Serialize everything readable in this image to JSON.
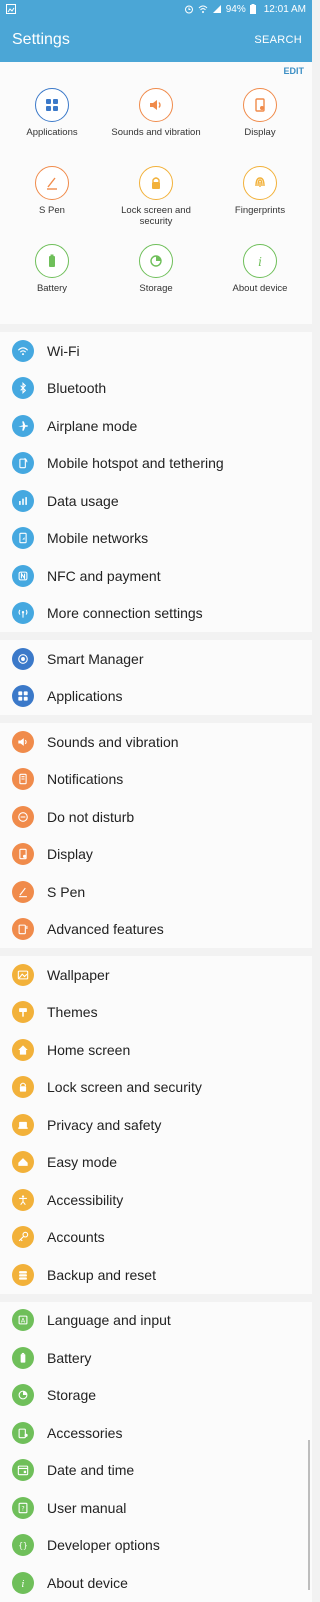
{
  "status": {
    "battery": "94%",
    "time": "12:01 AM"
  },
  "appbar": {
    "title": "Settings",
    "search": "SEARCH"
  },
  "quick": {
    "edit": "EDIT",
    "items": [
      {
        "label": "Applications",
        "icon": "apps-grid-icon",
        "color": "#3b79c9"
      },
      {
        "label": "Sounds and vibration",
        "icon": "speaker-icon",
        "color": "#f08b4b"
      },
      {
        "label": "Display",
        "icon": "display-icon",
        "color": "#f08b4b"
      },
      {
        "label": "S Pen",
        "icon": "pen-icon",
        "color": "#f08b4b"
      },
      {
        "label": "Lock screen and security",
        "icon": "lock-icon",
        "color": "#f2b13a"
      },
      {
        "label": "Fingerprints",
        "icon": "fingerprint-icon",
        "color": "#f2b13a"
      },
      {
        "label": "Battery",
        "icon": "battery-icon",
        "color": "#6fbf5a"
      },
      {
        "label": "Storage",
        "icon": "storage-icon",
        "color": "#6fbf5a"
      },
      {
        "label": "About device",
        "icon": "info-icon",
        "color": "#6fbf5a"
      }
    ]
  },
  "sections": [
    {
      "color": "#45a8e0",
      "items": [
        {
          "label": "Wi-Fi",
          "icon": "wifi-icon"
        },
        {
          "label": "Bluetooth",
          "icon": "bluetooth-icon"
        },
        {
          "label": "Airplane mode",
          "icon": "airplane-icon"
        },
        {
          "label": "Mobile hotspot and tethering",
          "icon": "hotspot-icon"
        },
        {
          "label": "Data usage",
          "icon": "data-usage-icon"
        },
        {
          "label": "Mobile networks",
          "icon": "mobile-networks-icon"
        },
        {
          "label": "NFC and payment",
          "icon": "nfc-icon"
        },
        {
          "label": "More connection settings",
          "icon": "connection-icon"
        }
      ]
    },
    {
      "color": "#3b79c9",
      "items": [
        {
          "label": "Smart Manager",
          "icon": "smart-manager-icon"
        },
        {
          "label": "Applications",
          "icon": "apps-grid-icon"
        }
      ]
    },
    {
      "color": "#f08b4b",
      "items": [
        {
          "label": "Sounds and vibration",
          "icon": "speaker-icon"
        },
        {
          "label": "Notifications",
          "icon": "notifications-icon"
        },
        {
          "label": "Do not disturb",
          "icon": "do-not-disturb-icon"
        },
        {
          "label": "Display",
          "icon": "display-icon"
        },
        {
          "label": "S Pen",
          "icon": "pen-icon"
        },
        {
          "label": "Advanced features",
          "icon": "advanced-features-icon"
        }
      ]
    },
    {
      "color": "#f2b13a",
      "items": [
        {
          "label": "Wallpaper",
          "icon": "wallpaper-icon"
        },
        {
          "label": "Themes",
          "icon": "themes-icon"
        },
        {
          "label": "Home screen",
          "icon": "home-icon"
        },
        {
          "label": "Lock screen and security",
          "icon": "lock-icon"
        },
        {
          "label": "Privacy and safety",
          "icon": "privacy-icon"
        },
        {
          "label": "Easy mode",
          "icon": "easy-mode-icon"
        },
        {
          "label": "Accessibility",
          "icon": "accessibility-icon"
        },
        {
          "label": "Accounts",
          "icon": "key-icon"
        },
        {
          "label": "Backup and reset",
          "icon": "backup-icon"
        }
      ]
    },
    {
      "color": "#6fbf5a",
      "items": [
        {
          "label": "Language and input",
          "icon": "language-icon"
        },
        {
          "label": "Battery",
          "icon": "battery-icon"
        },
        {
          "label": "Storage",
          "icon": "storage-icon"
        },
        {
          "label": "Accessories",
          "icon": "accessories-icon"
        },
        {
          "label": "Date and time",
          "icon": "calendar-icon"
        },
        {
          "label": "User manual",
          "icon": "manual-icon"
        },
        {
          "label": "Developer options",
          "icon": "developer-icon"
        },
        {
          "label": "About device",
          "icon": "info-icon"
        }
      ]
    }
  ]
}
